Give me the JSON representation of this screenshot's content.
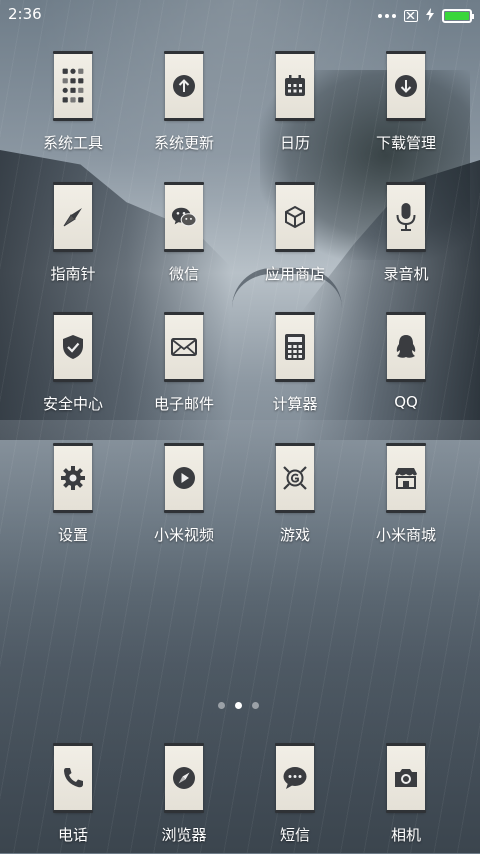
{
  "status_bar": {
    "time": "2:36",
    "battery_color": "#39d63b"
  },
  "apps": [
    {
      "label": "系统工具",
      "icon": "tools-folder-icon"
    },
    {
      "label": "系统更新",
      "icon": "update-arrow-icon"
    },
    {
      "label": "日历",
      "icon": "calendar-icon"
    },
    {
      "label": "下载管理",
      "icon": "download-icon"
    },
    {
      "label": "指南针",
      "icon": "compass-icon"
    },
    {
      "label": "微信",
      "icon": "wechat-icon"
    },
    {
      "label": "应用商店",
      "icon": "app-store-cube-icon"
    },
    {
      "label": "录音机",
      "icon": "microphone-icon"
    },
    {
      "label": "安全中心",
      "icon": "shield-check-icon"
    },
    {
      "label": "电子邮件",
      "icon": "mail-icon"
    },
    {
      "label": "计算器",
      "icon": "calculator-icon"
    },
    {
      "label": "QQ",
      "icon": "qq-penguin-icon"
    },
    {
      "label": "设置",
      "icon": "gear-icon"
    },
    {
      "label": "小米视频",
      "icon": "play-icon"
    },
    {
      "label": "游戏",
      "icon": "game-icon"
    },
    {
      "label": "小米商城",
      "icon": "store-icon"
    }
  ],
  "pager": {
    "active_index": 1,
    "count": 3
  },
  "dock": [
    {
      "label": "电话",
      "icon": "phone-icon"
    },
    {
      "label": "浏览器",
      "icon": "browser-compass-icon"
    },
    {
      "label": "短信",
      "icon": "message-bubble-icon"
    },
    {
      "label": "相机",
      "icon": "camera-icon"
    }
  ]
}
